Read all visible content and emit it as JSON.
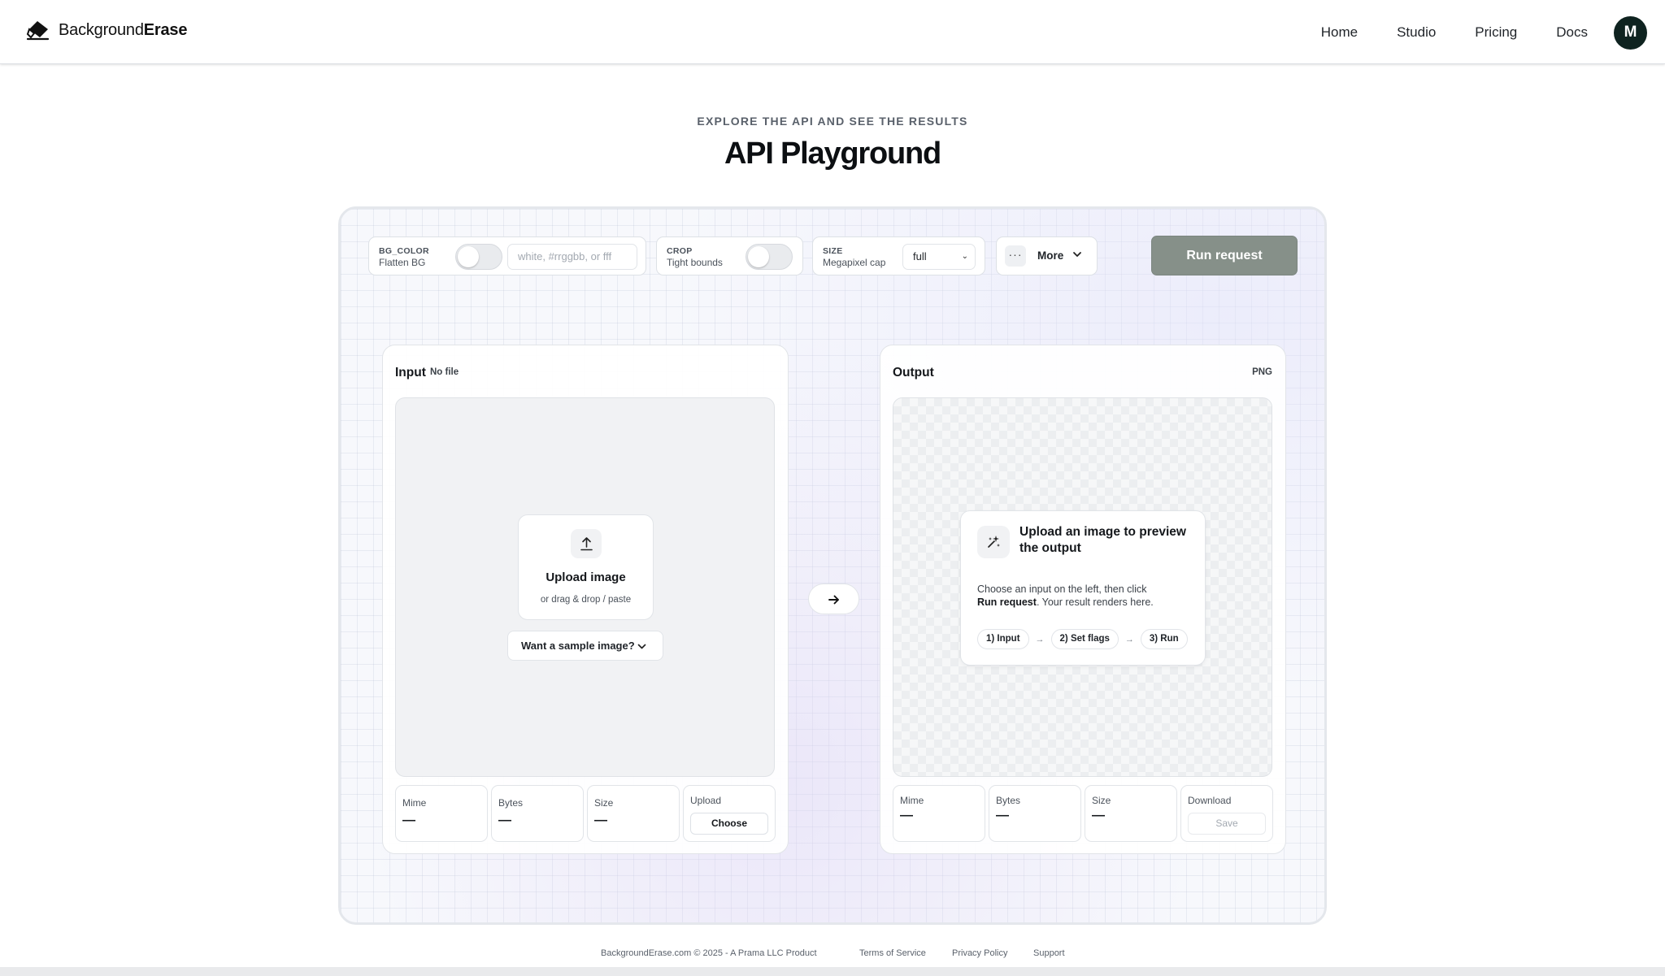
{
  "header": {
    "logo_text_regular": "Background",
    "logo_text_bold": "Erase",
    "nav": [
      "Home",
      "Studio",
      "Pricing",
      "Docs"
    ],
    "avatar_initial": "M"
  },
  "hero": {
    "eyebrow": "EXPLORE THE API AND SEE THE RESULTS",
    "title": "API Playground"
  },
  "controls": {
    "bg_color": {
      "key": "BG_COLOR",
      "sub": "Flatten BG",
      "enabled": false,
      "placeholder": "white, #rrggbb, or fff"
    },
    "crop": {
      "key": "CROP",
      "sub": "Tight bounds",
      "enabled": false
    },
    "size": {
      "key": "SIZE",
      "sub": "Megapixel cap",
      "value": "full"
    },
    "more": {
      "dots": "···",
      "label": "More"
    },
    "run_label": "Run request"
  },
  "input": {
    "title": "Input",
    "badge": "No file",
    "upload_title": "Upload image",
    "upload_sub": "or drag & drop / paste",
    "sample_label": "Want a sample image?",
    "stats": {
      "mime_label": "Mime",
      "mime_value": "—",
      "bytes_label": "Bytes",
      "bytes_value": "—",
      "size_label": "Size",
      "size_value": "—",
      "upload_label": "Upload",
      "upload_button": "Choose"
    }
  },
  "output": {
    "title": "Output",
    "format": "PNG",
    "preview_title": "Upload an image to preview the output",
    "preview_body_1": "Choose an input on the left, then click",
    "preview_body_bold": "Run request",
    "preview_body_2": ". Your result renders here.",
    "steps": [
      "1) Input",
      "2) Set flags",
      "3) Run"
    ],
    "step_arrow": "→",
    "stats": {
      "mime_label": "Mime",
      "mime_value": "—",
      "bytes_label": "Bytes",
      "bytes_value": "—",
      "size_label": "Size",
      "size_value": "—",
      "download_label": "Download",
      "download_button": "Save"
    }
  },
  "footer": {
    "copyright": "BackgroundErase.com © 2025 - A Prama LLC Product",
    "terms": "Terms of Service",
    "privacy": "Privacy Policy",
    "support": "Support"
  },
  "colors": {
    "run_button": "#869089",
    "avatar": "#0f2320",
    "panel_border": "#e4e7ec"
  },
  "icons": {
    "logo": "eraser-icon",
    "upload": "upload-arrow-icon",
    "sparkle": "sparkle-wand-icon",
    "arrow": "arrow-right-icon",
    "chevron": "chevron-down-icon"
  }
}
